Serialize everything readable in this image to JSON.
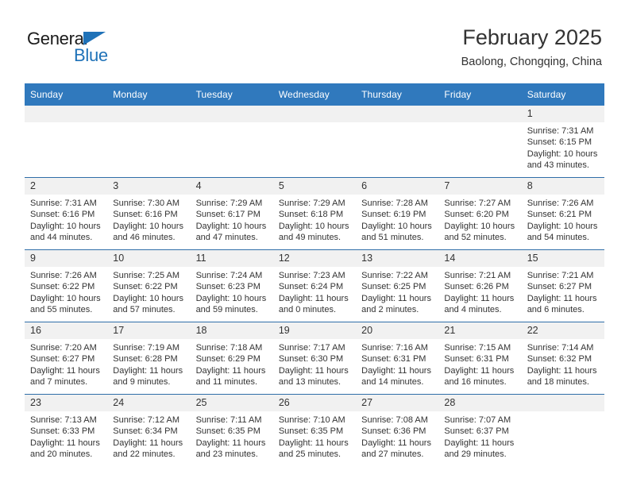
{
  "brand": {
    "name_part1": "General",
    "name_part2": "Blue",
    "accent_color": "#1f72b8"
  },
  "header": {
    "title": "February 2025",
    "subtitle": "Baolong, Chongqing, China"
  },
  "theme": {
    "header_row_bg": "#3079bd",
    "row_divider": "#2f6ea8",
    "daynum_bg": "#f1f1f1",
    "text": "#333333"
  },
  "weekdays": [
    "Sunday",
    "Monday",
    "Tuesday",
    "Wednesday",
    "Thursday",
    "Friday",
    "Saturday"
  ],
  "weeks": [
    [
      {
        "day": "",
        "sunrise": "",
        "sunset": "",
        "daylight1": "",
        "daylight2": ""
      },
      {
        "day": "",
        "sunrise": "",
        "sunset": "",
        "daylight1": "",
        "daylight2": ""
      },
      {
        "day": "",
        "sunrise": "",
        "sunset": "",
        "daylight1": "",
        "daylight2": ""
      },
      {
        "day": "",
        "sunrise": "",
        "sunset": "",
        "daylight1": "",
        "daylight2": ""
      },
      {
        "day": "",
        "sunrise": "",
        "sunset": "",
        "daylight1": "",
        "daylight2": ""
      },
      {
        "day": "",
        "sunrise": "",
        "sunset": "",
        "daylight1": "",
        "daylight2": ""
      },
      {
        "day": "1",
        "sunrise": "Sunrise: 7:31 AM",
        "sunset": "Sunset: 6:15 PM",
        "daylight1": "Daylight: 10 hours",
        "daylight2": "and 43 minutes."
      }
    ],
    [
      {
        "day": "2",
        "sunrise": "Sunrise: 7:31 AM",
        "sunset": "Sunset: 6:16 PM",
        "daylight1": "Daylight: 10 hours",
        "daylight2": "and 44 minutes."
      },
      {
        "day": "3",
        "sunrise": "Sunrise: 7:30 AM",
        "sunset": "Sunset: 6:16 PM",
        "daylight1": "Daylight: 10 hours",
        "daylight2": "and 46 minutes."
      },
      {
        "day": "4",
        "sunrise": "Sunrise: 7:29 AM",
        "sunset": "Sunset: 6:17 PM",
        "daylight1": "Daylight: 10 hours",
        "daylight2": "and 47 minutes."
      },
      {
        "day": "5",
        "sunrise": "Sunrise: 7:29 AM",
        "sunset": "Sunset: 6:18 PM",
        "daylight1": "Daylight: 10 hours",
        "daylight2": "and 49 minutes."
      },
      {
        "day": "6",
        "sunrise": "Sunrise: 7:28 AM",
        "sunset": "Sunset: 6:19 PM",
        "daylight1": "Daylight: 10 hours",
        "daylight2": "and 51 minutes."
      },
      {
        "day": "7",
        "sunrise": "Sunrise: 7:27 AM",
        "sunset": "Sunset: 6:20 PM",
        "daylight1": "Daylight: 10 hours",
        "daylight2": "and 52 minutes."
      },
      {
        "day": "8",
        "sunrise": "Sunrise: 7:26 AM",
        "sunset": "Sunset: 6:21 PM",
        "daylight1": "Daylight: 10 hours",
        "daylight2": "and 54 minutes."
      }
    ],
    [
      {
        "day": "9",
        "sunrise": "Sunrise: 7:26 AM",
        "sunset": "Sunset: 6:22 PM",
        "daylight1": "Daylight: 10 hours",
        "daylight2": "and 55 minutes."
      },
      {
        "day": "10",
        "sunrise": "Sunrise: 7:25 AM",
        "sunset": "Sunset: 6:22 PM",
        "daylight1": "Daylight: 10 hours",
        "daylight2": "and 57 minutes."
      },
      {
        "day": "11",
        "sunrise": "Sunrise: 7:24 AM",
        "sunset": "Sunset: 6:23 PM",
        "daylight1": "Daylight: 10 hours",
        "daylight2": "and 59 minutes."
      },
      {
        "day": "12",
        "sunrise": "Sunrise: 7:23 AM",
        "sunset": "Sunset: 6:24 PM",
        "daylight1": "Daylight: 11 hours",
        "daylight2": "and 0 minutes."
      },
      {
        "day": "13",
        "sunrise": "Sunrise: 7:22 AM",
        "sunset": "Sunset: 6:25 PM",
        "daylight1": "Daylight: 11 hours",
        "daylight2": "and 2 minutes."
      },
      {
        "day": "14",
        "sunrise": "Sunrise: 7:21 AM",
        "sunset": "Sunset: 6:26 PM",
        "daylight1": "Daylight: 11 hours",
        "daylight2": "and 4 minutes."
      },
      {
        "day": "15",
        "sunrise": "Sunrise: 7:21 AM",
        "sunset": "Sunset: 6:27 PM",
        "daylight1": "Daylight: 11 hours",
        "daylight2": "and 6 minutes."
      }
    ],
    [
      {
        "day": "16",
        "sunrise": "Sunrise: 7:20 AM",
        "sunset": "Sunset: 6:27 PM",
        "daylight1": "Daylight: 11 hours",
        "daylight2": "and 7 minutes."
      },
      {
        "day": "17",
        "sunrise": "Sunrise: 7:19 AM",
        "sunset": "Sunset: 6:28 PM",
        "daylight1": "Daylight: 11 hours",
        "daylight2": "and 9 minutes."
      },
      {
        "day": "18",
        "sunrise": "Sunrise: 7:18 AM",
        "sunset": "Sunset: 6:29 PM",
        "daylight1": "Daylight: 11 hours",
        "daylight2": "and 11 minutes."
      },
      {
        "day": "19",
        "sunrise": "Sunrise: 7:17 AM",
        "sunset": "Sunset: 6:30 PM",
        "daylight1": "Daylight: 11 hours",
        "daylight2": "and 13 minutes."
      },
      {
        "day": "20",
        "sunrise": "Sunrise: 7:16 AM",
        "sunset": "Sunset: 6:31 PM",
        "daylight1": "Daylight: 11 hours",
        "daylight2": "and 14 minutes."
      },
      {
        "day": "21",
        "sunrise": "Sunrise: 7:15 AM",
        "sunset": "Sunset: 6:31 PM",
        "daylight1": "Daylight: 11 hours",
        "daylight2": "and 16 minutes."
      },
      {
        "day": "22",
        "sunrise": "Sunrise: 7:14 AM",
        "sunset": "Sunset: 6:32 PM",
        "daylight1": "Daylight: 11 hours",
        "daylight2": "and 18 minutes."
      }
    ],
    [
      {
        "day": "23",
        "sunrise": "Sunrise: 7:13 AM",
        "sunset": "Sunset: 6:33 PM",
        "daylight1": "Daylight: 11 hours",
        "daylight2": "and 20 minutes."
      },
      {
        "day": "24",
        "sunrise": "Sunrise: 7:12 AM",
        "sunset": "Sunset: 6:34 PM",
        "daylight1": "Daylight: 11 hours",
        "daylight2": "and 22 minutes."
      },
      {
        "day": "25",
        "sunrise": "Sunrise: 7:11 AM",
        "sunset": "Sunset: 6:35 PM",
        "daylight1": "Daylight: 11 hours",
        "daylight2": "and 23 minutes."
      },
      {
        "day": "26",
        "sunrise": "Sunrise: 7:10 AM",
        "sunset": "Sunset: 6:35 PM",
        "daylight1": "Daylight: 11 hours",
        "daylight2": "and 25 minutes."
      },
      {
        "day": "27",
        "sunrise": "Sunrise: 7:08 AM",
        "sunset": "Sunset: 6:36 PM",
        "daylight1": "Daylight: 11 hours",
        "daylight2": "and 27 minutes."
      },
      {
        "day": "28",
        "sunrise": "Sunrise: 7:07 AM",
        "sunset": "Sunset: 6:37 PM",
        "daylight1": "Daylight: 11 hours",
        "daylight2": "and 29 minutes."
      },
      {
        "day": "",
        "sunrise": "",
        "sunset": "",
        "daylight1": "",
        "daylight2": ""
      }
    ]
  ]
}
